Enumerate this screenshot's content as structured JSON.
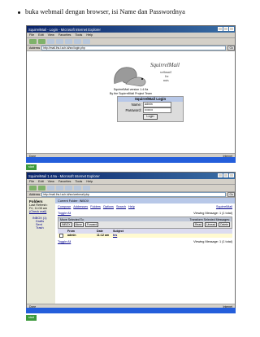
{
  "bullet_text": "buka webmail dengan browser, isi Name dan Passwordnya",
  "win1": {
    "title": "SquirrelMail - Login - Microsoft Internet Explorer",
    "menu": [
      "File",
      "Edit",
      "View",
      "Favorites",
      "Tools",
      "Help"
    ],
    "address_label": "Address",
    "address": "http://mail.lhs.l.sch.id/src/login.php",
    "go": "Go",
    "logo_lines": [
      "SquirrelMail",
      "webmail",
      "for",
      "nuts"
    ],
    "version": "SquirrelMail version 1.4.9a",
    "by": "By the SquirrelMail Project Team",
    "login_header": "SquirrelMail Login",
    "name_label": "Name:",
    "name_value": "admin",
    "password_label": "Password:",
    "password_value": "••••••••",
    "login_button": "Login",
    "status_left": "Done",
    "status_right": "Internet",
    "start": "start"
  },
  "win2": {
    "title": "SquirrelMail 1.4.9a - Microsoft Internet Explorer",
    "menu": [
      "File",
      "Edit",
      "View",
      "Favorites",
      "Tools",
      "Help"
    ],
    "address_label": "Address",
    "address": "http://mail.lhs.l.sch.id/src/webmail.php",
    "go": "Go",
    "sidebar": {
      "heading": "Folders",
      "refresh": "Last Refresh:",
      "refresh_time": "Fri, 11:08 am",
      "check": "(Check mail)",
      "folders": [
        "INBOX (1)",
        "Drafts",
        "Sent",
        "Trash"
      ]
    },
    "current_folder": "Current Folder: INBOX",
    "nav": [
      "Compose",
      "Addresses",
      "Folders",
      "Options",
      "Search",
      "Help"
    ],
    "brand": "SquirrelMail",
    "toggle_all": "Toggle All",
    "viewing": "Viewing Message: 1 (1 total)",
    "move_selected": "Move Selected To:",
    "transform": "Transform Selected Messages:",
    "move_folder": "INBOX",
    "move_btn": "Move",
    "forward_btn": "Forward",
    "read_btn": "Read",
    "unread_btn": "Unread",
    "delete_btn": "Delete",
    "columns": [
      "",
      "From",
      "Date",
      "Subject"
    ],
    "message": {
      "from": "admin",
      "date": "11:12 am",
      "subject": "tes"
    },
    "status_left": "Done",
    "status_right": "Internet",
    "start": "start"
  }
}
